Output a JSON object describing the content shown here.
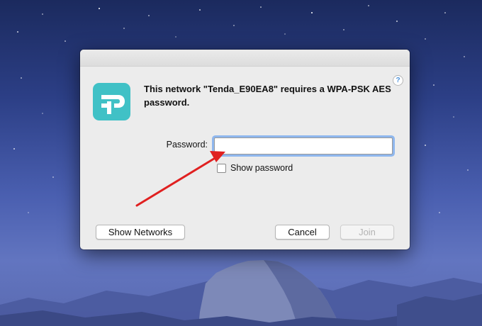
{
  "dialog": {
    "message": "This network \"Tenda_E90EA8\" requires a WPA-PSK AES password.",
    "password_label": "Password:",
    "password_value": "",
    "show_password_label": "Show password",
    "help_label": "?",
    "buttons": {
      "show_networks": "Show Networks",
      "cancel": "Cancel",
      "join": "Join"
    },
    "app_icon": "tp-link-logo",
    "show_password_checked": false,
    "join_enabled": false
  },
  "colors": {
    "app_icon_bg": "#40c1c6",
    "focus_ring": "#8fb7ee",
    "annotation_arrow": "#e02020"
  }
}
